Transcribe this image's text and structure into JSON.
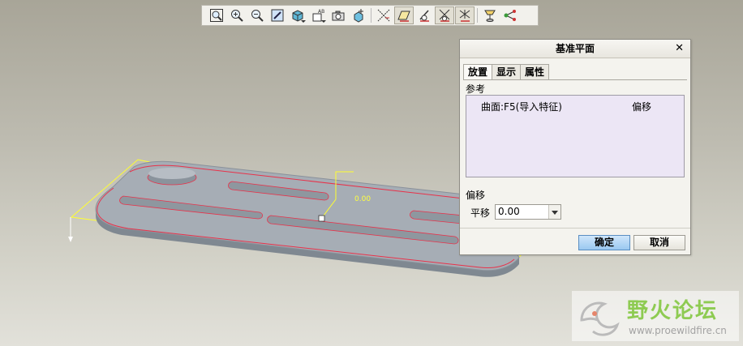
{
  "toolbar": {
    "buttons": [
      {
        "name": "zoom-fit-icon"
      },
      {
        "name": "zoom-in-icon"
      },
      {
        "name": "zoom-out-icon"
      },
      {
        "name": "repaint-icon"
      },
      {
        "name": "display-style-icon"
      },
      {
        "name": "saved-views-icon"
      },
      {
        "name": "camera-icon"
      },
      {
        "name": "spin-center-icon"
      },
      {
        "name": "datum-axis-icon"
      },
      {
        "name": "datum-plane-display-icon"
      },
      {
        "name": "datum-point-display-icon"
      },
      {
        "name": "coordinate-system-icon"
      },
      {
        "name": "annotation-icon"
      },
      {
        "name": "reorient-icon"
      },
      {
        "name": "network-icon"
      }
    ]
  },
  "viewport": {
    "offset_dimension": "0.00"
  },
  "dialog": {
    "title": "基准平面",
    "close_symbol": "✕",
    "tabs": [
      "放置",
      "显示",
      "属性"
    ],
    "references_label": "参考",
    "reference": {
      "item": "曲面:F5(导入特征)",
      "constraint": "偏移"
    },
    "offset_section_label": "偏移",
    "translate_label": "平移",
    "translate_value": "0.00",
    "ok_label": "确定",
    "cancel_label": "取消"
  },
  "watermark": {
    "title": "野火论坛",
    "url": "www.proewildfire.cn"
  },
  "colors": {
    "part_edge": "#e8324a",
    "datum_yellow": "#ffff40",
    "part_fill": "#9aa3ad",
    "reference_box": "#ece6f5"
  }
}
